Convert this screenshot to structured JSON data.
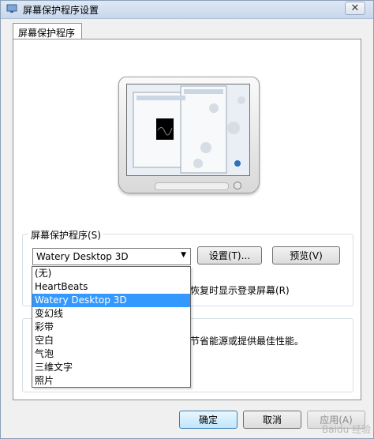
{
  "window": {
    "title": "屏幕保护程序设置"
  },
  "tab": {
    "label": "屏幕保护程序"
  },
  "screensaver_group": {
    "title": "屏幕保护程序(S)",
    "selected": "Watery Desktop 3D",
    "settings_button": "设置(T)...",
    "preview_button": "预览(V)",
    "resume_text": "恢复时显示登录屏幕(R)",
    "options": [
      "(无)",
      "HeartBeats",
      "Watery Desktop 3D",
      "变幻线",
      "彩带",
      "空白",
      "气泡",
      "三维文字",
      "照片"
    ],
    "selected_index": 2
  },
  "power_group": {
    "partial_text": "节省能源或提供最佳性能。"
  },
  "footer": {
    "ok": "确定",
    "cancel": "取消",
    "apply": "应用(A)"
  },
  "watermark": "Baidu 经验",
  "colors": {
    "selection": "#3399ff",
    "title_gradient_top": "#dfe9f5"
  }
}
